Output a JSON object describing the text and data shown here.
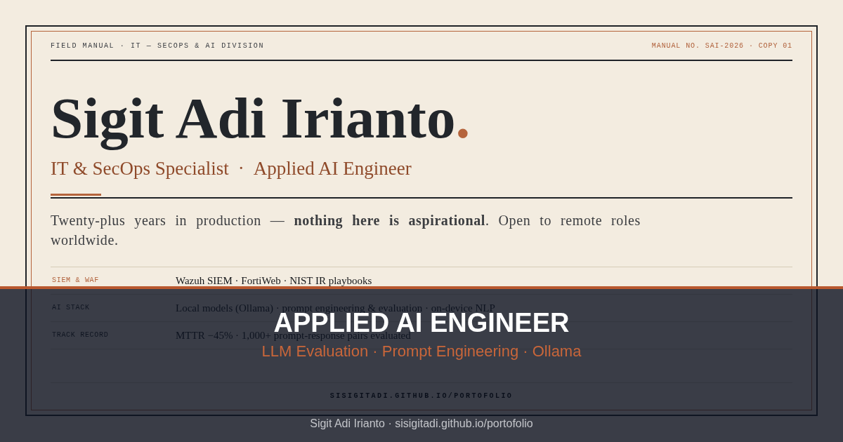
{
  "header": {
    "series": "FIELD MANUAL · IT — SECOPS & AI DIVISION",
    "manual_number": "MANUAL NO. SAI-2026 · COPY 01"
  },
  "hero": {
    "name": "Sigit Adi Irianto",
    "name_mark": ".",
    "subtitle": [
      "IT & SecOps Specialist",
      "·",
      "Applied AI Engineer"
    ]
  },
  "intro": "Twenty-plus years in production — **nothing here is aspirational**. Open to remote roles worldwide.",
  "specs": [
    {
      "label": "SIEM & WAF",
      "value": "Wazuh SIEM · FortiWeb · NIST IR playbooks",
      "highlighted": true
    },
    {
      "label": "AI STACK",
      "value": "Local models (Ollama) · prompt engineering & evaluation · on-device NLP",
      "highlighted": false
    },
    {
      "label": "TRACK RECORD",
      "value": "MTTR −45% · 1,000+ prompt-response pairs evaluated",
      "highlighted": false
    }
  ],
  "footer": {
    "url": "SISIGITADI.GITHUB.IO/PORTOFOLIO"
  },
  "banner": {
    "headline": "APPLIED AI ENGINEER",
    "tags": "LLM Evaluation · Prompt Engineering · Ollama",
    "caption": "Sigit Adi Irianto · sisigitadi.github.io/portofolio"
  }
}
